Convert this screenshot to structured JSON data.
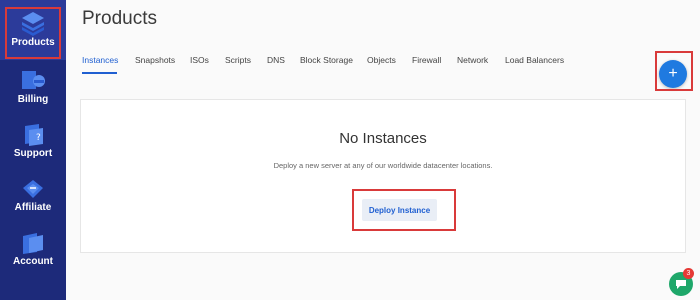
{
  "sidebar": {
    "items": [
      {
        "label": "Products",
        "icon": "layers-icon"
      },
      {
        "label": "Billing",
        "icon": "billing-icon"
      },
      {
        "label": "Support",
        "icon": "support-icon"
      },
      {
        "label": "Affiliate",
        "icon": "affiliate-icon"
      },
      {
        "label": "Account",
        "icon": "account-icon"
      }
    ]
  },
  "page": {
    "title": "Products"
  },
  "tabs": [
    "Instances",
    "Snapshots",
    "ISOs",
    "Scripts",
    "DNS",
    "Block Storage",
    "Objects",
    "Firewall",
    "Network",
    "Load Balancers"
  ],
  "empty_state": {
    "title": "No Instances",
    "subtitle": "Deploy a new server at any of our worldwide datacenter locations.",
    "button": "Deploy Instance"
  },
  "fab": {
    "label": "+"
  },
  "chat": {
    "badge": "3"
  },
  "colors": {
    "sidebar": "#1d2a7a",
    "accent": "#1f5fd1",
    "highlight": "#d93a3a",
    "chat": "#1ea76a"
  }
}
